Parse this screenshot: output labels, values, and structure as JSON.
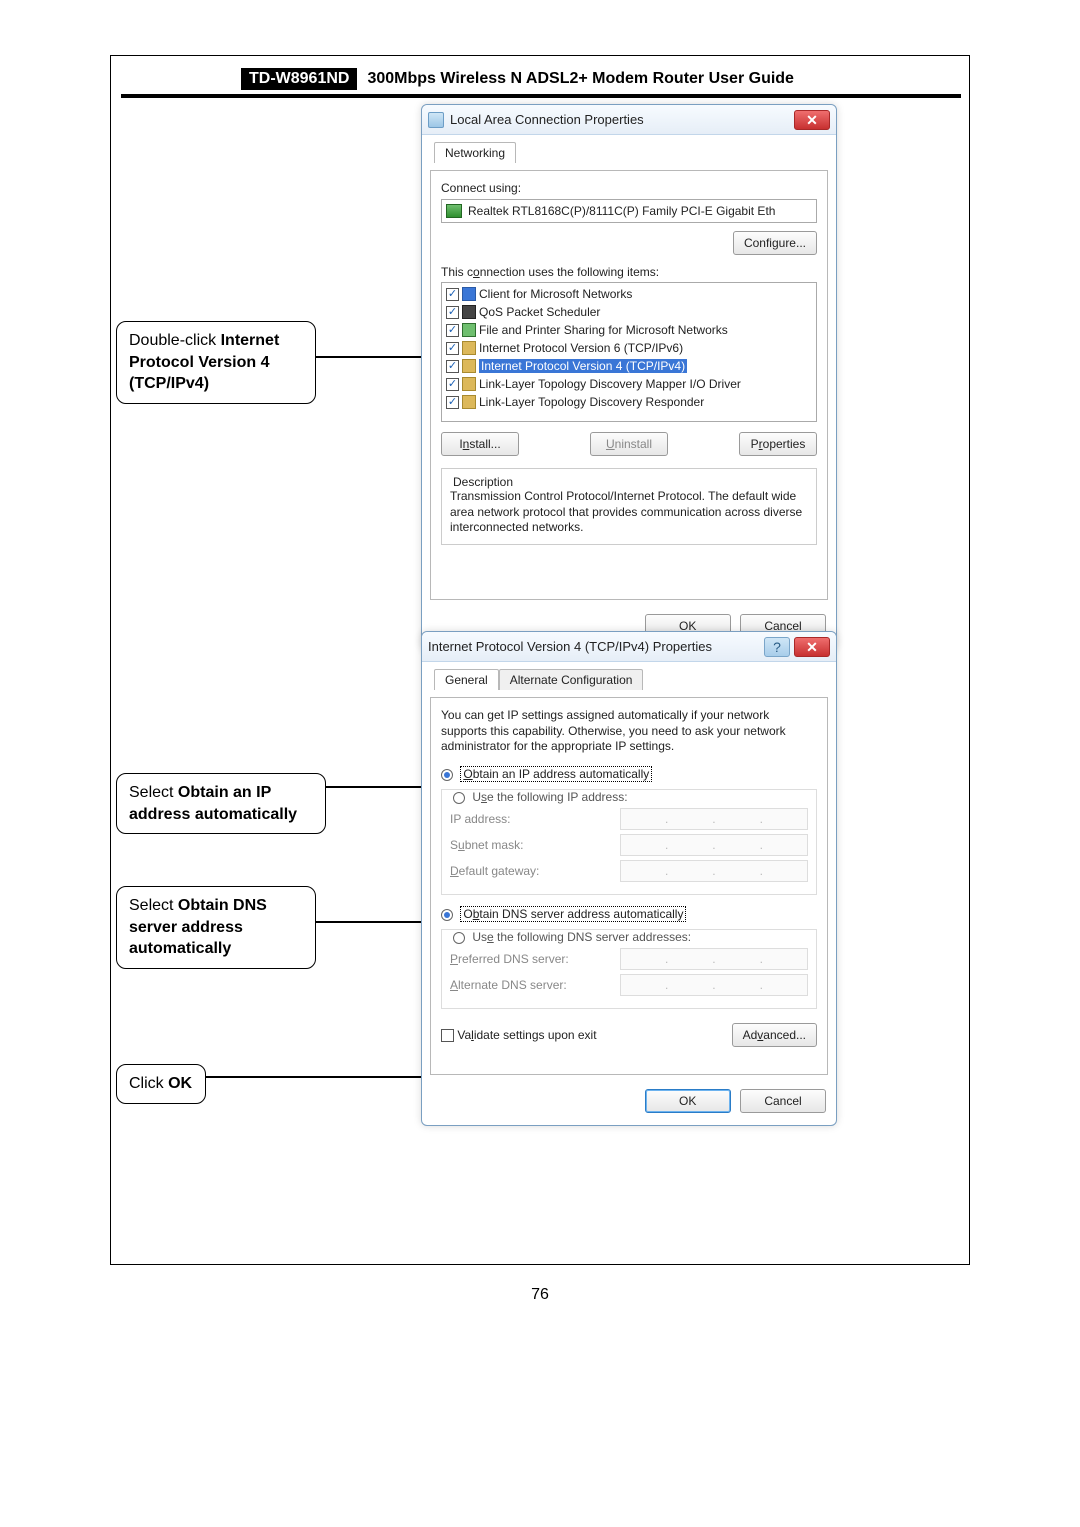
{
  "header": {
    "model": "TD-W8961ND",
    "title": "300Mbps Wireless N ADSL2+ Modem Router User Guide"
  },
  "page_number": "76",
  "callouts": {
    "c1a": "Double-click ",
    "c1b": "Internet Protocol Version 4 (TCP/IPv4)",
    "c2a": "Select ",
    "c2b": "Obtain an IP address automatically",
    "c3a": "Select ",
    "c3b": "Obtain DNS server address automatically",
    "c4a": "Click ",
    "c4b": "OK"
  },
  "dialog1": {
    "title": "Local Area Connection Properties",
    "close": "✕",
    "tab": "Networking",
    "connect_using_label": "Connect using:",
    "adapter": "Realtek RTL8168C(P)/8111C(P) Family PCI-E Gigabit Eth",
    "configure": "Configure...",
    "items_label": "This connection uses the following items:",
    "items": [
      "Client for Microsoft Networks",
      "QoS Packet Scheduler",
      "File and Printer Sharing for Microsoft Networks",
      "Internet Protocol Version 6 (TCP/IPv6)",
      "Internet Protocol Version 4 (TCP/IPv4)",
      "Link-Layer Topology Discovery Mapper I/O Driver",
      "Link-Layer Topology Discovery Responder"
    ],
    "install": "Install...",
    "uninstall": "Uninstall",
    "properties": "Properties",
    "desc_legend": "Description",
    "description": "Transmission Control Protocol/Internet Protocol. The default wide area network protocol that provides communication across diverse interconnected networks.",
    "ok": "OK",
    "cancel": "Cancel"
  },
  "dialog2": {
    "title": "Internet Protocol Version 4 (TCP/IPv4) Properties",
    "help": "?",
    "close": "✕",
    "tab_general": "General",
    "tab_alt": "Alternate Configuration",
    "intro": "You can get IP settings assigned automatically if your network supports this capability. Otherwise, you need to ask your network administrator for the appropriate IP settings.",
    "r_obtain_ip": "Obtain an IP address automatically",
    "r_use_ip": "Use the following IP address:",
    "ip_label": "IP address:",
    "subnet_label": "Subnet mask:",
    "gateway_label": "Default gateway:",
    "r_obtain_dns": "Obtain DNS server address automatically",
    "r_use_dns": "Use the following DNS server addresses:",
    "pref_dns": "Preferred DNS server:",
    "alt_dns": "Alternate DNS server:",
    "validate": "Validate settings upon exit",
    "advanced": "Advanced...",
    "ok": "OK",
    "cancel": "Cancel"
  }
}
